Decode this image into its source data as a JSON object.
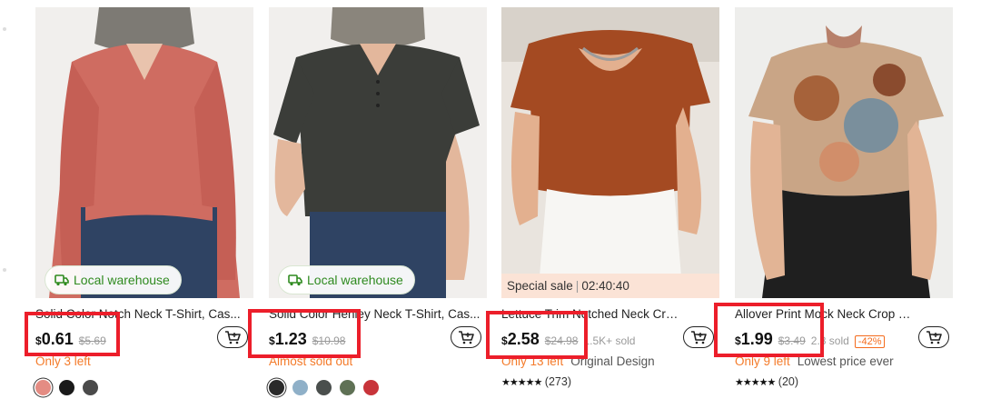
{
  "icons": {
    "warehouse": "local-warehouse-icon",
    "cart": "add-to-cart-icon",
    "star": "star-icon"
  },
  "colors": {
    "accent_orange": "#f47b2a",
    "highlight_red": "#ec1e2a",
    "warehouse_green": "#2f8a1f",
    "sale_bg": "#fbe3d6"
  },
  "products": [
    {
      "title": "Solid Color Notch Neck T-Shirt, Cas...",
      "currency": "$",
      "price": "0.61",
      "original_price": "$5.69",
      "badge": "Local warehouse",
      "stock": "Only 3 left",
      "swatches": [
        "#e48c83",
        "#1a1a1a",
        "#4a4a4a"
      ]
    },
    {
      "title": "Solid Color Henley Neck T-Shirt, Cas...",
      "currency": "$",
      "price": "1.23",
      "original_price": "$10.98",
      "badge": "Local warehouse",
      "stock": "Almost sold out",
      "swatches": [
        "#2a2a2a",
        "#8fb0c8",
        "#4a4f4d",
        "#5f7155",
        "#c8343a"
      ]
    },
    {
      "title": "Lettuce Trim Notched Neck Crop T-...",
      "currency": "$",
      "price": "2.58",
      "original_price": "$24.98",
      "sold": "1.5K+ sold",
      "sale_label": "Special sale",
      "countdown": "02:40:40",
      "stock": "Only 13 left",
      "note": "Original Design",
      "stars": "★★★★★",
      "rating_count": "(273)"
    },
    {
      "title": "Allover Print Mock Neck Crop Top, Y...",
      "currency": "$",
      "price": "1.99",
      "original_price": "$3.49",
      "sold": "2.8 sold",
      "discount": "-42%",
      "stock": "Only 9 left",
      "note": "Lowest price ever",
      "stars": "★★★★★",
      "rating_count": "(20)"
    }
  ]
}
